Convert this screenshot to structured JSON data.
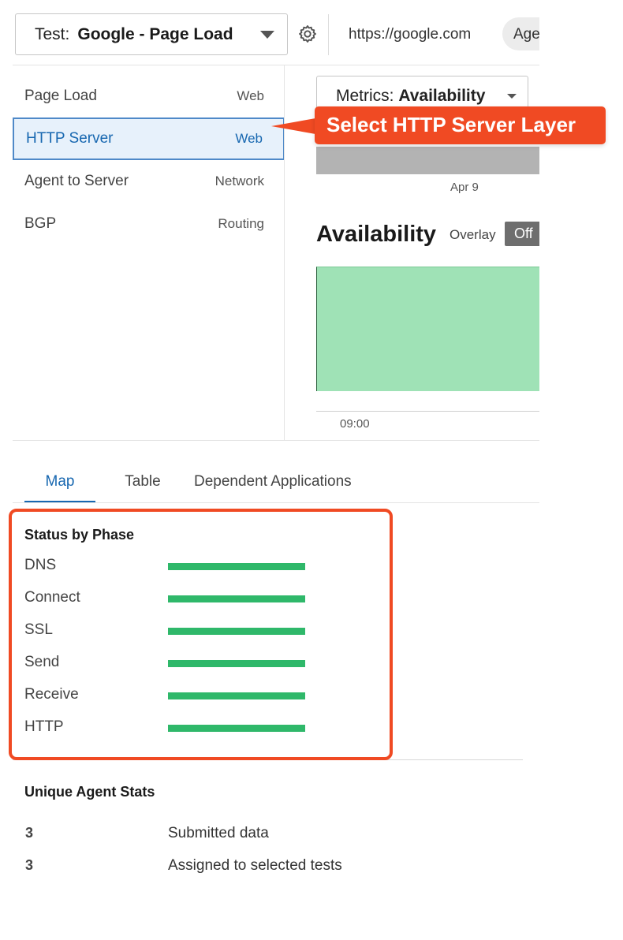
{
  "header": {
    "test_prefix": "Test:",
    "test_name": "Google - Page Load",
    "url": "https://google.com",
    "agent_pill": "Agents"
  },
  "layers": [
    {
      "label": "Page Load",
      "type": "Web"
    },
    {
      "label": "HTTP Server",
      "type": "Web",
      "selected": true
    },
    {
      "label": "Agent to Server",
      "type": "Network"
    },
    {
      "label": "BGP",
      "type": "Routing"
    }
  ],
  "metrics": {
    "prefix": "Metrics:",
    "value": "Availability",
    "timeline_date": "Apr 9"
  },
  "availability": {
    "title": "Availability",
    "overlay_label": "Overlay",
    "overlay_state": "Off",
    "time_label": "09:00"
  },
  "tabs": [
    "Map",
    "Table",
    "Dependent Applications"
  ],
  "status_by_phase": {
    "title": "Status by Phase",
    "phases": [
      {
        "name": "DNS",
        "status": "ok"
      },
      {
        "name": "Connect",
        "status": "ok"
      },
      {
        "name": "SSL",
        "status": "ok"
      },
      {
        "name": "Send",
        "status": "ok"
      },
      {
        "name": "Receive",
        "status": "ok"
      },
      {
        "name": "HTTP",
        "status": "ok"
      }
    ],
    "bar_color": "#2fb86a"
  },
  "agent_stats": {
    "title": "Unique Agent Stats",
    "rows": [
      {
        "count": "3",
        "label": "Submitted data"
      },
      {
        "count": "3",
        "label": "Assigned to selected tests"
      }
    ]
  },
  "annotation": {
    "callout_text": "Select HTTP Server Layer",
    "color": "#f04a23"
  },
  "icons": [
    "chevron-down-icon",
    "gear-icon"
  ]
}
